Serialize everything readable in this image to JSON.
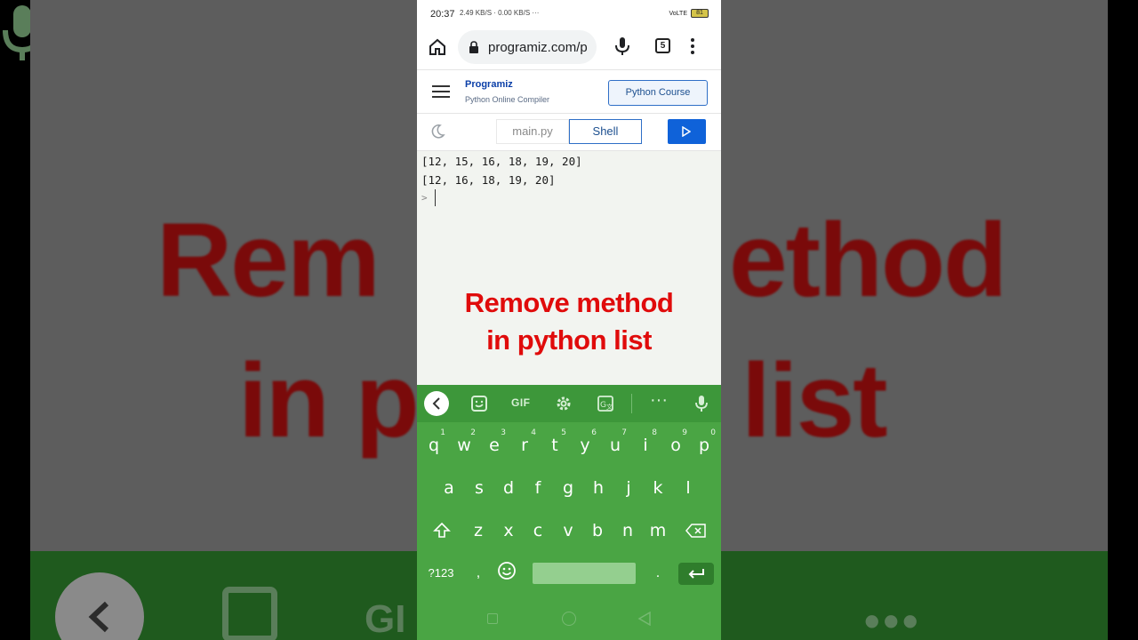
{
  "background": {
    "title_fragment_line1_left": "Rem",
    "title_fragment_line1_right": "ethod",
    "title_fragment_line2_left": "in p",
    "title_fragment_line2_right": "list",
    "gif_label": "GI",
    "dots": "•••"
  },
  "status_bar": {
    "time": "20:37",
    "extra": "2.49 KB/S · 0.00 KB/S ···",
    "network": "VoLTE",
    "battery": "81"
  },
  "browser": {
    "url": "programiz.com/p",
    "tab_count": "5",
    "icons": [
      "home-icon",
      "lock-icon",
      "mic-icon",
      "tabs-icon",
      "menu-icon"
    ]
  },
  "site": {
    "logo": "Programiz",
    "subtitle": "Python Online Compiler",
    "course_button": "Python Course"
  },
  "toolbar": {
    "tab_main": "main.py",
    "tab_shell": "Shell",
    "run_icon": "play-icon"
  },
  "console": {
    "lines": [
      "[12, 15, 16, 18, 19, 20]",
      "[12, 16, 18, 19, 20]"
    ],
    "prompt": ">"
  },
  "overlay": {
    "line1": "Remove method",
    "line2": "in python list"
  },
  "keyboard": {
    "toolbar_gif": "GIF",
    "toolbar_dots": "···",
    "row1": [
      "q",
      "w",
      "e",
      "r",
      "t",
      "y",
      "u",
      "i",
      "o",
      "p"
    ],
    "row1_hints": [
      "1",
      "2",
      "3",
      "4",
      "5",
      "6",
      "7",
      "8",
      "9",
      "0"
    ],
    "row2": [
      "a",
      "s",
      "d",
      "f",
      "g",
      "h",
      "j",
      "k",
      "l"
    ],
    "row3": [
      "z",
      "x",
      "c",
      "v",
      "b",
      "n",
      "m"
    ],
    "symbols_key": "?123",
    "comma": ",",
    "period": "."
  },
  "colors": {
    "keyboard_bg": "#4aa544",
    "title_red": "#e00b0b",
    "run_blue": "#0f62d9"
  }
}
